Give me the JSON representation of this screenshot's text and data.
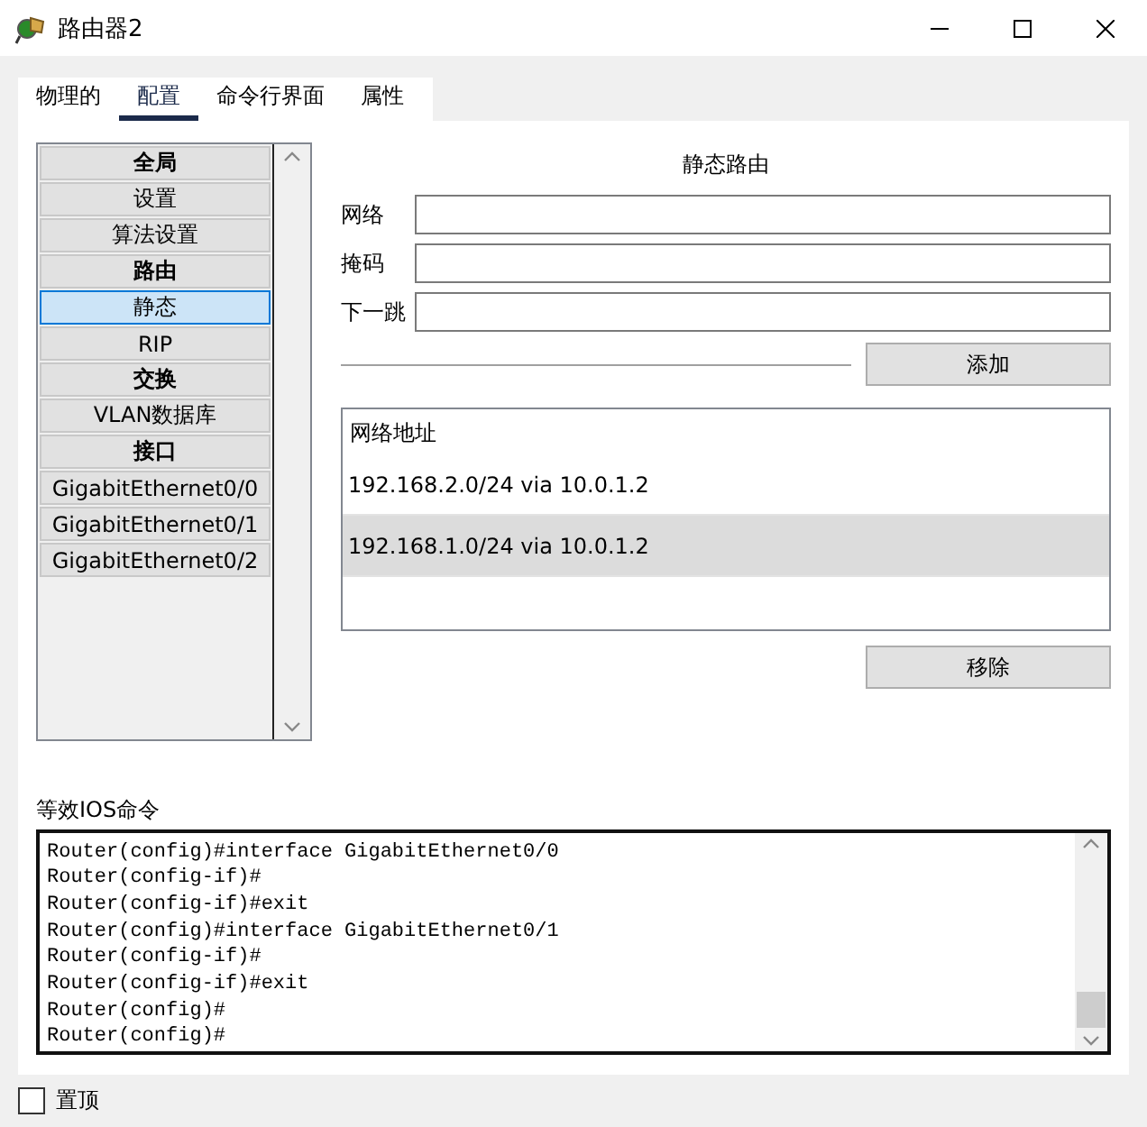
{
  "window": {
    "title": "路由器2"
  },
  "tabs": [
    {
      "label": "物理的",
      "selected": false
    },
    {
      "label": "配置",
      "selected": true
    },
    {
      "label": "命令行界面",
      "selected": false
    },
    {
      "label": "属性",
      "selected": false
    }
  ],
  "sidebar": {
    "items": [
      {
        "label": "全局",
        "kind": "header",
        "selected": false
      },
      {
        "label": "设置",
        "kind": "item",
        "selected": false
      },
      {
        "label": "算法设置",
        "kind": "item",
        "selected": false
      },
      {
        "label": "路由",
        "kind": "header",
        "selected": false
      },
      {
        "label": "静态",
        "kind": "item",
        "selected": true
      },
      {
        "label": "RIP",
        "kind": "item",
        "selected": false
      },
      {
        "label": "交换",
        "kind": "header",
        "selected": false
      },
      {
        "label": "VLAN数据库",
        "kind": "item",
        "selected": false
      },
      {
        "label": "接口",
        "kind": "header",
        "selected": false
      },
      {
        "label": "GigabitEthernet0/0",
        "kind": "item",
        "selected": false
      },
      {
        "label": "GigabitEthernet0/1",
        "kind": "item",
        "selected": false
      },
      {
        "label": "GigabitEthernet0/2",
        "kind": "item",
        "selected": false
      }
    ]
  },
  "static_route": {
    "title": "静态路由",
    "fields": [
      {
        "label": "网络"
      },
      {
        "label": "掩码"
      },
      {
        "label": "下一跳"
      }
    ],
    "add_button": "添加",
    "table": {
      "header": "网络地址",
      "rows": [
        {
          "text": "192.168.2.0/24 via 10.0.1.2",
          "selected": false
        },
        {
          "text": "192.168.1.0/24 via 10.0.1.2",
          "selected": true
        }
      ]
    },
    "remove_button": "移除"
  },
  "console": {
    "label": "等效IOS命令",
    "lines": [
      "Router(config)#interface GigabitEthernet0/0",
      "Router(config-if)#",
      "Router(config-if)#exit",
      "Router(config)#interface GigabitEthernet0/1",
      "Router(config-if)#",
      "Router(config-if)#exit",
      "Router(config)#",
      "Router(config)#"
    ]
  },
  "footer": {
    "checkbox": {
      "label": "置顶",
      "checked": false
    }
  }
}
